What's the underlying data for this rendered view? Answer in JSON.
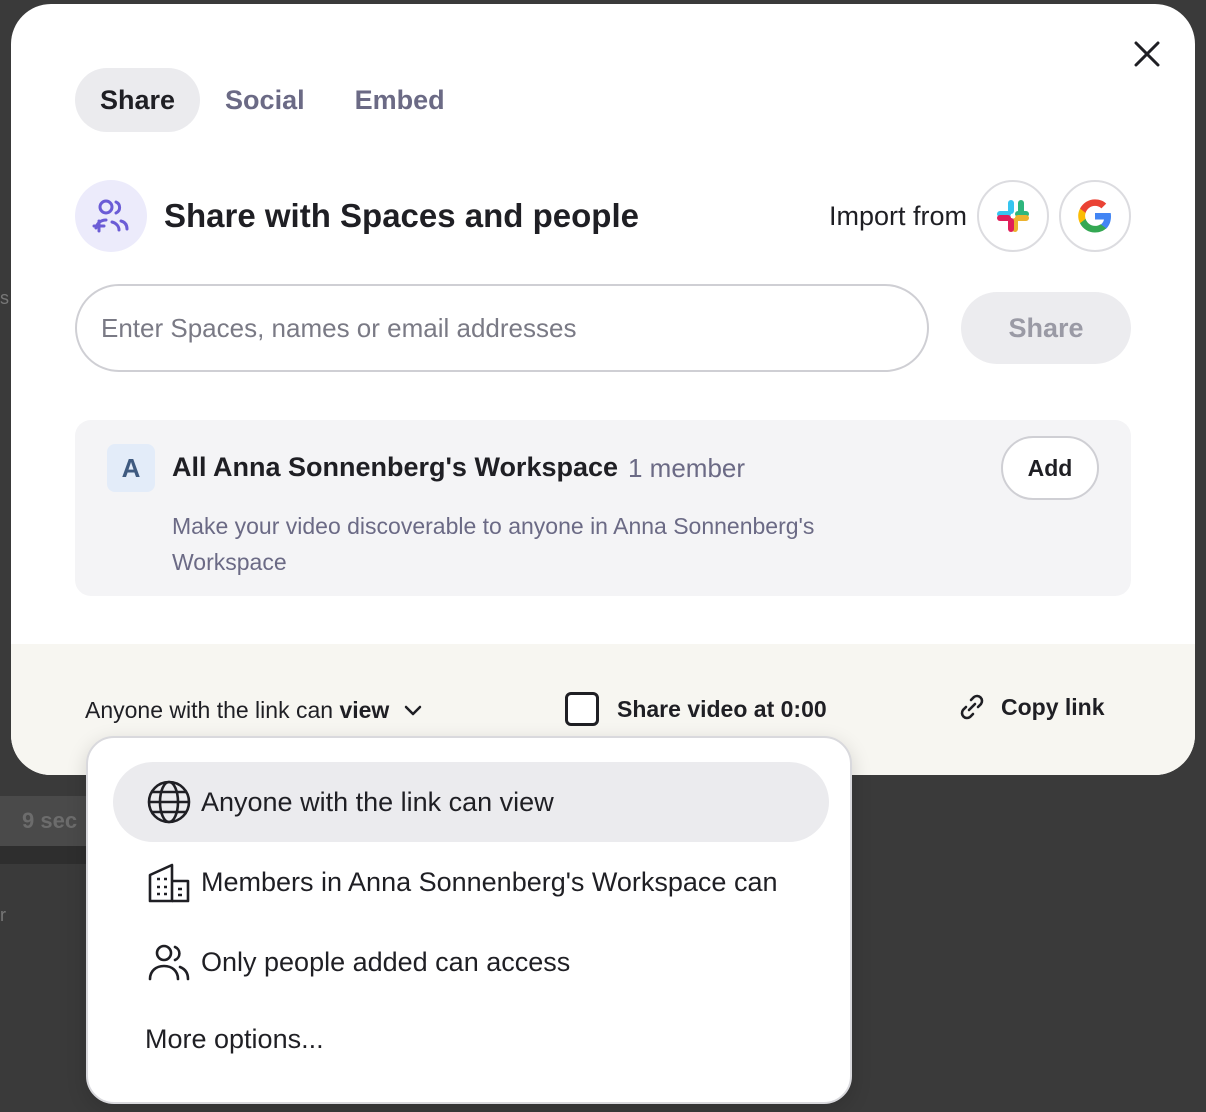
{
  "background": {
    "chip_text": "9 sec",
    "mark1": "s",
    "mark2": "r"
  },
  "tabs": [
    {
      "label": "Share",
      "active": true
    },
    {
      "label": "Social",
      "active": false
    },
    {
      "label": "Embed",
      "active": false
    }
  ],
  "section": {
    "title": "Share with Spaces and people",
    "icon": "people-add-icon"
  },
  "import": {
    "label": "Import from",
    "sources": [
      "slack-icon",
      "google-icon"
    ]
  },
  "invite": {
    "placeholder": "Enter Spaces, names or email addresses",
    "value": "",
    "share_label": "Share"
  },
  "workspace": {
    "avatar_letter": "A",
    "name": "All Anna Sonnenberg's Workspace",
    "member_count": "1 member",
    "description": "Make your video discoverable to anyone in Anna Sonnenberg's Workspace",
    "add_label": "Add"
  },
  "footer": {
    "access_prefix": "Anyone with the link can",
    "access_level": "view",
    "share_time_label": "Share video at 0:00",
    "share_time_checked": false,
    "copy_link_label": "Copy link"
  },
  "access_menu": {
    "items": [
      {
        "label": "Anyone with the link can view",
        "icon": "globe-icon",
        "selected": true
      },
      {
        "label": "Members in Anna Sonnenberg's Workspace can",
        "icon": "building-icon",
        "selected": false
      },
      {
        "label": "Only people added can access",
        "icon": "people-icon",
        "selected": false
      }
    ],
    "more_label": "More options..."
  },
  "colors": {
    "accent": "#6b5cd6",
    "muted_text": "#6b6a85",
    "footer_bg": "#f7f6f1"
  }
}
